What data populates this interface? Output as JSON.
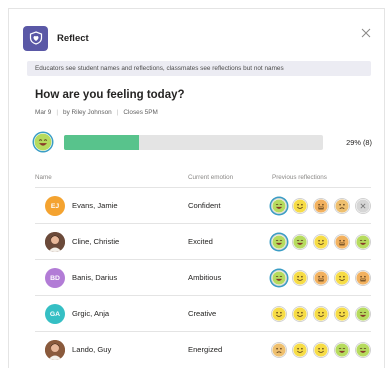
{
  "app": {
    "title": "Reflect",
    "icon": "heart-shield-icon",
    "close_icon": "close-icon"
  },
  "banner": "Educators see student names and reflections, classmates see reflections but not names",
  "question": "How are you feeling today?",
  "meta": {
    "date": "Mar 9",
    "author": "by Riley Johnson",
    "closes": "Closes 5PM"
  },
  "summary": {
    "emoji": "very-happy-emoji",
    "progress": 0.29,
    "text": "29% (8)"
  },
  "columns": {
    "name": "Name",
    "emotion": "Current emotion",
    "previous": "Previous reflections"
  },
  "students": [
    {
      "name": "Evans, Jamie",
      "initials": "EJ",
      "avatar_color": "#f4a330",
      "emotion": "Confident",
      "reflections": [
        "very-happy",
        "happy",
        "neutral",
        "sad",
        "none"
      ]
    },
    {
      "name": "Cline, Christie",
      "initials": "",
      "avatar_color": "#6b4a3a",
      "photo": true,
      "emotion": "Excited",
      "reflections": [
        "very-happy",
        "very-happy",
        "happy",
        "neutral",
        "very-happy"
      ]
    },
    {
      "name": "Banis, Darius",
      "initials": "BD",
      "avatar_color": "#b27cd6",
      "emotion": "Ambitious",
      "reflections": [
        "very-happy",
        "happy",
        "neutral",
        "happy",
        "neutral"
      ]
    },
    {
      "name": "Grgic, Anja",
      "initials": "GA",
      "avatar_color": "#35bfc4",
      "emotion": "Creative",
      "reflections": [
        "happy",
        "happy",
        "happy",
        "happy",
        "very-happy"
      ]
    },
    {
      "name": "Lando, Guy",
      "initials": "",
      "avatar_color": "#8a5a3c",
      "photo": true,
      "emotion": "Energized",
      "reflections": [
        "sad",
        "happy",
        "happy",
        "very-happy",
        "very-happy"
      ]
    }
  ],
  "colors": {
    "accent": "#5a58a6",
    "progress": "#58c38c",
    "very-happy": "#b6db5e",
    "happy": "#f6dc46",
    "neutral": "#f2b15f",
    "sad": "#eebf6e"
  }
}
